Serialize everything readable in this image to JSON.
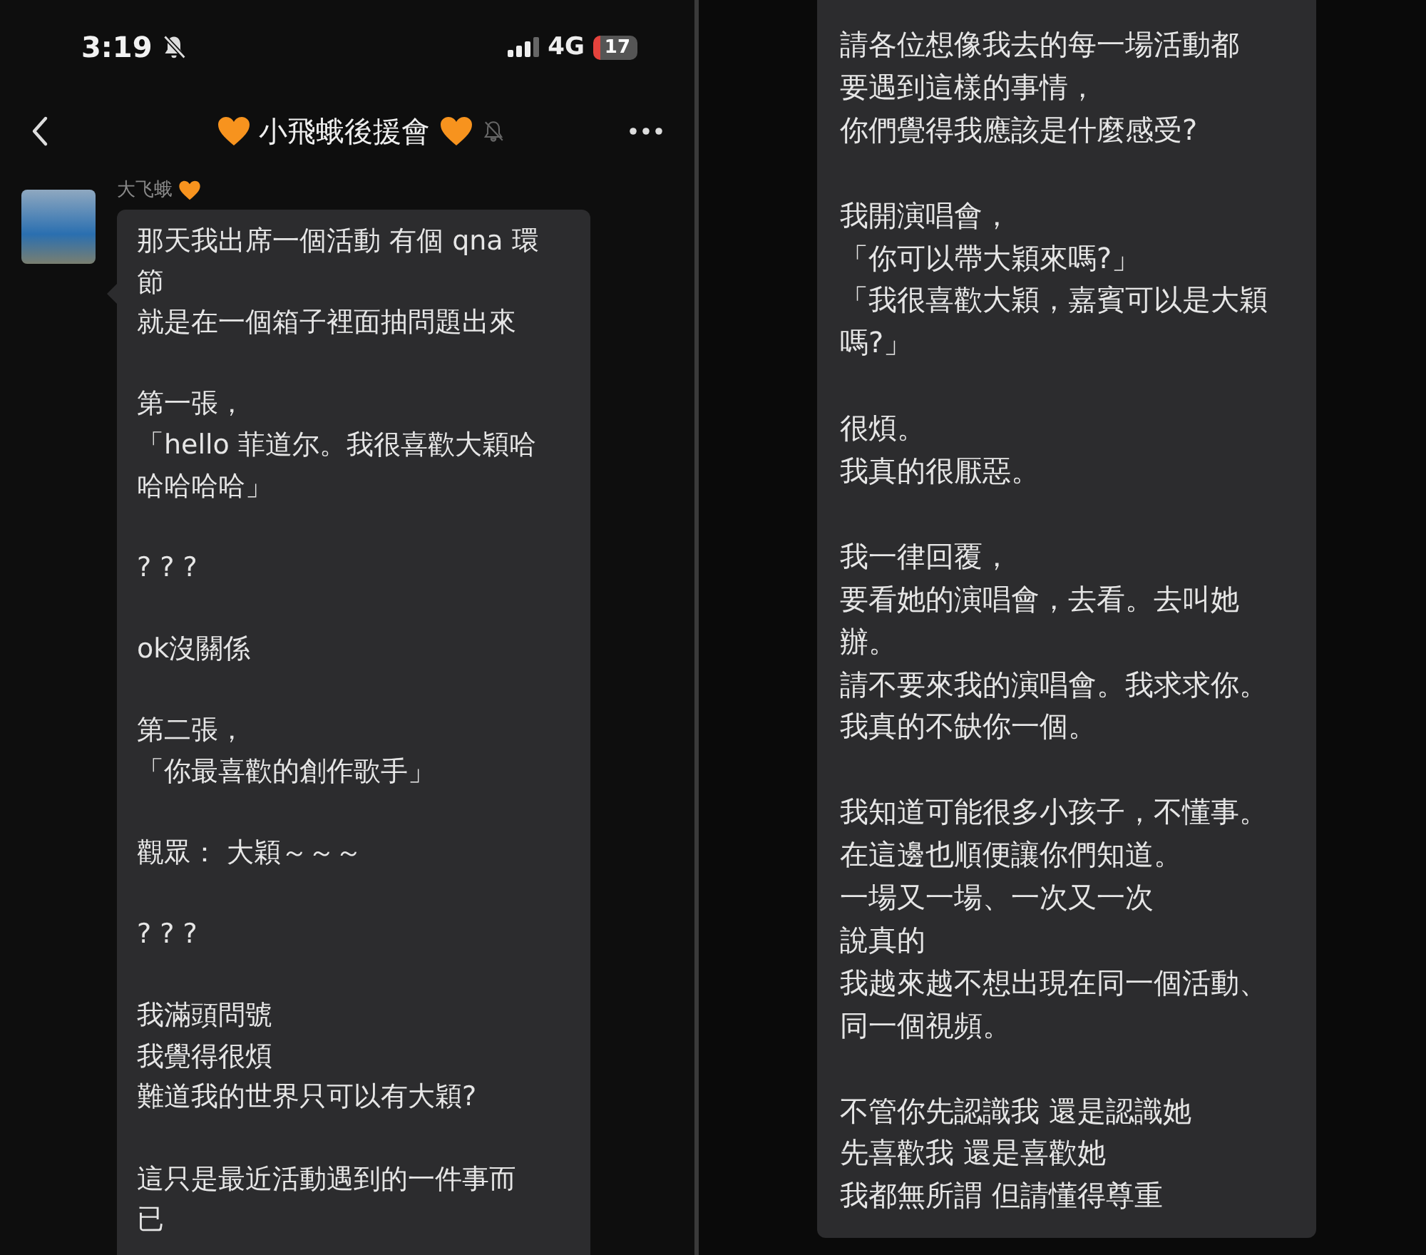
{
  "left_screen": {
    "status_bar": {
      "time": "3:19",
      "network": "4G",
      "battery": "17"
    },
    "header": {
      "title": "小飛蛾後援會"
    },
    "message": {
      "sender": "大飞蛾",
      "paragraphs": [
        [
          "那天我出席一個活動 有個 qna 環",
          "節",
          "就是在一個箱子裡面抽問題出來"
        ],
        [
          "第一張，",
          "「hello 菲道尔。我很喜歡大穎哈",
          "哈哈哈哈」"
        ],
        [
          "? ? ?"
        ],
        [
          "ok沒關係"
        ],
        [
          "第二張，",
          "「你最喜歡的創作歌手」"
        ],
        [
          "觀眾： 大穎～～～"
        ],
        [
          "? ? ?"
        ],
        [
          "我滿頭問號",
          "我覺得很煩",
          "難道我的世界只可以有大穎?"
        ],
        [
          "這只是最近活動遇到的一件事而",
          "已"
        ]
      ]
    }
  },
  "right_screen": {
    "message": {
      "paragraphs": [
        [
          "請各位想像我去的每一場活動都",
          "要遇到這樣的事情，",
          "你們覺得我應該是什麼感受?"
        ],
        [
          "我開演唱會，",
          "「你可以帶大穎來嗎?」",
          "「我很喜歡大穎，嘉賓可以是大穎",
          "嗎?」"
        ],
        [
          "很煩。",
          "我真的很厭惡。"
        ],
        [
          "我一律回覆，",
          "要看她的演唱會，去看。去叫她",
          "辦。",
          "請不要來我的演唱會。我求求你。",
          "我真的不缺你一個。"
        ],
        [
          "我知道可能很多小孩子，不懂事。",
          "在這邊也順便讓你們知道。",
          "一場又一場、一次又一次",
          "說真的",
          "我越來越不想出現在同一個活動、",
          "同一個視頻。"
        ],
        [
          "不管你先認識我 還是認識她",
          "先喜歡我 還是喜歡她",
          "我都無所謂 但請懂得尊重"
        ]
      ]
    }
  }
}
